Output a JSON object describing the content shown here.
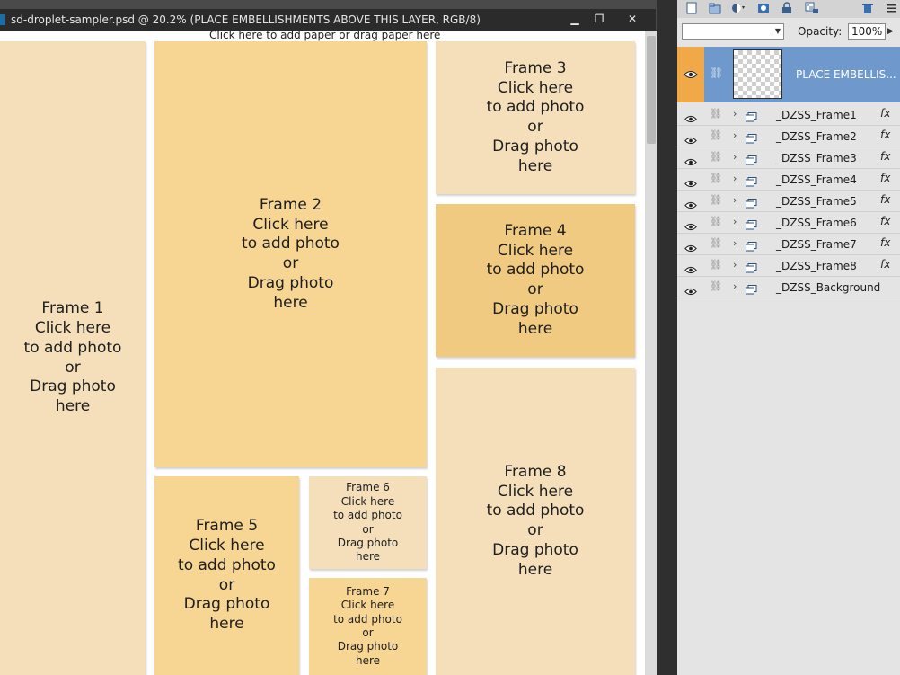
{
  "window": {
    "title": "sd-droplet-sampler.psd @ 20.2% (PLACE EMBELLISHMENTS ABOVE THIS LAYER, RGB/8)",
    "minimize_glyph": "▁",
    "restore_glyph": "❐",
    "close_glyph": "✕"
  },
  "canvas": {
    "paper_hint": "Click here to add paper or drag paper here",
    "frames": [
      {
        "text": "Frame 1\nClick here\nto add photo\nor\nDrag photo\nhere"
      },
      {
        "text": "Frame 2\nClick here\nto add photo\nor\nDrag photo\nhere"
      },
      {
        "text": "Frame 3\nClick here\nto add photo\nor\nDrag photo\nhere"
      },
      {
        "text": "Frame 4\nClick here\nto add photo\nor\nDrag photo\nhere"
      },
      {
        "text": "Frame 8\nClick here\nto add photo\nor\nDrag photo\nhere"
      },
      {
        "text": "Frame 5\nClick here\nto add photo\nor\nDrag photo\nhere"
      },
      {
        "text": "Frame 6\nClick here\nto add photo\nor\nDrag photo\nhere"
      },
      {
        "text": "Frame 7\nClick here\nto add photo\nor\nDrag photo\nhere"
      }
    ]
  },
  "layers_panel": {
    "blend_mode": "",
    "opacity_label": "Opacity:",
    "opacity_value": "100%",
    "active_layer": {
      "name": "PLACE EMBELLIS..."
    },
    "layers": [
      {
        "name": "_DZSS_Frame1",
        "fx": "fx"
      },
      {
        "name": "_DZSS_Frame2",
        "fx": "fx"
      },
      {
        "name": "_DZSS_Frame3",
        "fx": "fx"
      },
      {
        "name": "_DZSS_Frame4",
        "fx": "fx"
      },
      {
        "name": "_DZSS_Frame5",
        "fx": "fx"
      },
      {
        "name": "_DZSS_Frame6",
        "fx": "fx"
      },
      {
        "name": "_DZSS_Frame7",
        "fx": "fx"
      },
      {
        "name": "_DZSS_Frame8",
        "fx": "fx"
      },
      {
        "name": "_DZSS_Background",
        "fx": ""
      }
    ]
  },
  "colors": {
    "frame_light": "#f5dfbb",
    "frame_mid": "#f7d592",
    "frame_dark": "#efca80",
    "active_layer_bg": "#6f98cc",
    "active_eye_bg": "#f0a849"
  }
}
